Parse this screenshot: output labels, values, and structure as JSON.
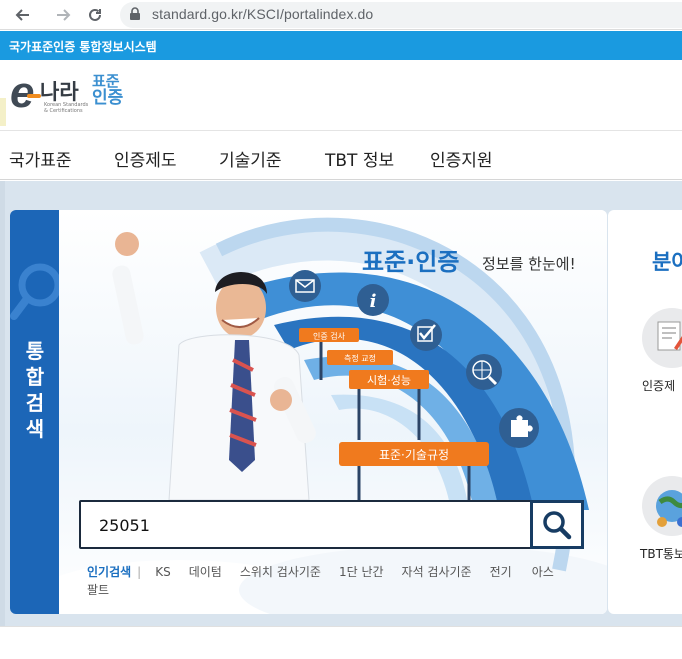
{
  "browser": {
    "url": "standard.go.kr/KSCI/portalindex.do"
  },
  "site": {
    "top_title": "국가표준인증 통합정보시스템",
    "logo_e": "e",
    "logo_main": "나라",
    "logo_std_1": "표준",
    "logo_std_2": "인증",
    "logo_en_1": "Korean Standards",
    "logo_en_2": "& Certifications"
  },
  "menu": {
    "items": [
      {
        "label": "국가표준"
      },
      {
        "label": "인증제도"
      },
      {
        "label": "기술기준"
      },
      {
        "label": "TBT 정보"
      },
      {
        "label": "인증지원"
      }
    ]
  },
  "search": {
    "side_label": [
      "통",
      "합",
      "검",
      "색"
    ],
    "headline": "표준·인증",
    "headline_sub": "정보를 한눈에!",
    "banner_tags": [
      "인증 검사",
      "측정 교정",
      "시험·성능",
      "표준·기술규정"
    ],
    "input_value": "25051",
    "popular_label": "인기검색",
    "popular_sep": "|",
    "popular_keywords": [
      "KS",
      "데이텀",
      "스위치 검사기준",
      "1단 난간",
      "자석 검사기준",
      "전기",
      "아스팔트"
    ]
  },
  "field_panel": {
    "title": "분야",
    "items": [
      {
        "label": "인증제"
      },
      {
        "label": "TBT통보"
      }
    ]
  },
  "colors": {
    "accent": "#1b6fc0",
    "top_strip": "#1a9ae0",
    "side_tab": "#1c66b7",
    "tag_orange": "#f07a1e"
  }
}
